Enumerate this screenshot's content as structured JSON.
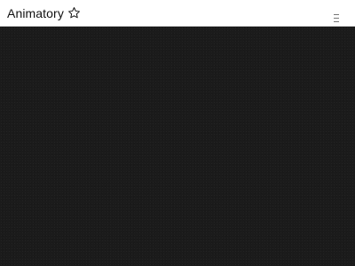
{
  "header": {
    "app_name": "Animatory",
    "favorite_icon": "star-outline-icon",
    "menu_icon": "hamburger-menu-icon"
  },
  "colors": {
    "header_background": "#ffffff",
    "canvas_background": "#1b1b1b",
    "title_text": "#111111"
  }
}
